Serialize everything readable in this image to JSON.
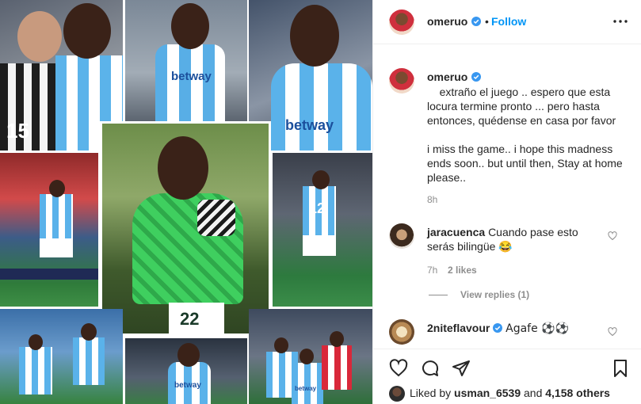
{
  "header": {
    "username": "omeruo",
    "separator": "•",
    "follow_label": "Follow"
  },
  "post": {
    "username": "omeruo",
    "caption": "extraño el juego .. espero que esta locura termine pronto ... pero hasta entonces, quédense en casa por favor\n\ni miss the game.. i hope this madness ends soon.. but until then, Stay at home please..",
    "time_ago": "8h",
    "photo_texts": {
      "sponsor_1": "betway",
      "sponsor_2": "betway",
      "sponsor_3": "betway",
      "sponsor_4": "betway",
      "big_number": "22",
      "number_12": "12",
      "number_15": "15"
    }
  },
  "comments": [
    {
      "username": "jaracuenca",
      "text": "Cuando pase esto serás bilingüe 😂",
      "time_ago": "7h",
      "likes": "2 likes",
      "view_replies": "View replies (1)"
    },
    {
      "username": "2niteflavour",
      "text": "Agafe ⚽⚽"
    }
  ],
  "footer": {
    "liked_by_prefix": "Liked by",
    "liked_by_user": "usman_6539",
    "liked_by_suffix": "and",
    "others_count": "4,158 others"
  },
  "icons": {
    "verified": "verified-badge-icon",
    "more": "more-options-icon",
    "like": "heart-icon",
    "comment": "comment-bubble-icon",
    "share": "paper-plane-icon",
    "save": "bookmark-icon"
  },
  "colors": {
    "accent": "#0095f6",
    "muted": "#8e8e8e",
    "leganes_blue": "#4aa3de",
    "nigeria_green": "#3bc45a"
  }
}
